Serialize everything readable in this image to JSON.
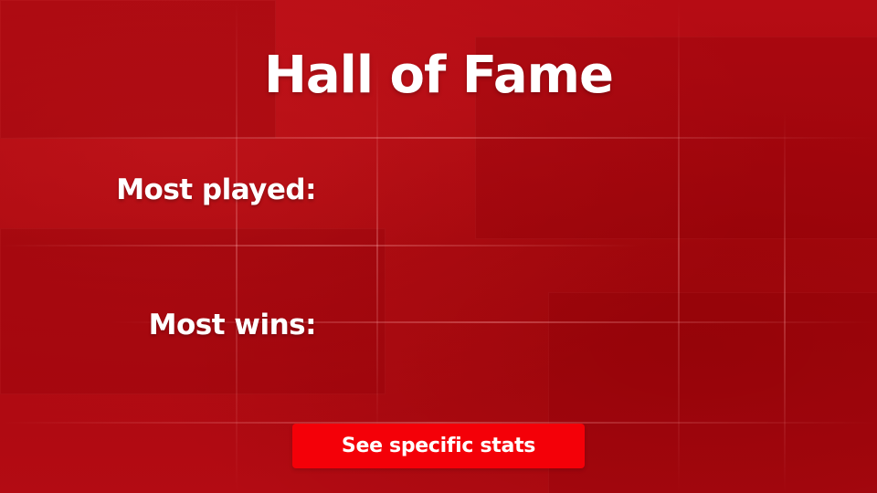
{
  "screen": {
    "title": "Hall of Fame",
    "background_color": "#b40a12"
  },
  "stats": {
    "most_played_label": "Most played:",
    "most_played_value": "",
    "most_wins_label": "Most wins:",
    "most_wins_value": ""
  },
  "actions": {
    "see_specific_stats_label": "See specific stats",
    "button_color": "#f40008"
  }
}
